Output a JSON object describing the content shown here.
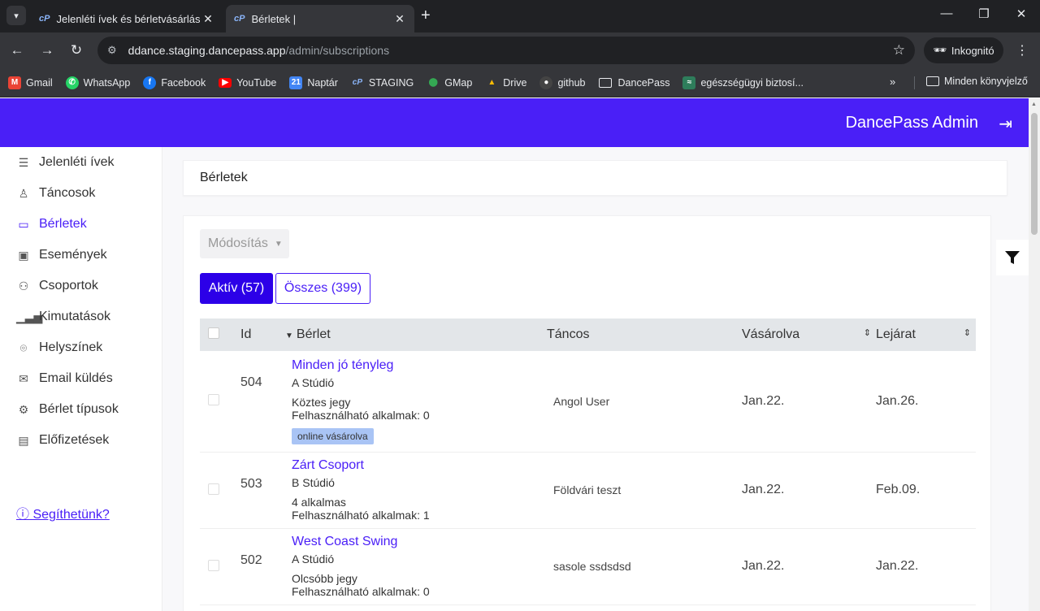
{
  "browser": {
    "tabs": [
      {
        "favicon": "cP",
        "title": "Jelenléti ívek és bérletvásárlás |",
        "active": false
      },
      {
        "favicon": "cP",
        "title": "Bérletek |",
        "active": true
      }
    ],
    "url_host": "ddance.staging.dancepass.app",
    "url_path": "/admin/subscriptions",
    "incognito_label": "Inkognitó",
    "bookmarks": [
      {
        "label": "Gmail",
        "icon": "gmail-icon",
        "color": "#ea4335"
      },
      {
        "label": "WhatsApp",
        "icon": "whatsapp-icon",
        "color": "#25d366"
      },
      {
        "label": "Facebook",
        "icon": "facebook-icon",
        "color": "#1877f2"
      },
      {
        "label": "YouTube",
        "icon": "youtube-icon",
        "color": "#ff0000"
      },
      {
        "label": "Naptár",
        "icon": "calendar-icon",
        "color": "#4285f4"
      },
      {
        "label": "STAGING",
        "icon": "dancepass-icon",
        "color": "#35363a"
      },
      {
        "label": "GMap",
        "icon": "maps-icon",
        "color": "#34a853"
      },
      {
        "label": "Drive",
        "icon": "drive-icon",
        "color": "#fbbc04"
      },
      {
        "label": "github",
        "icon": "github-icon",
        "color": "#24292e"
      },
      {
        "label": "DancePass",
        "icon": "folder-icon",
        "color": "#35363a"
      },
      {
        "label": "egészségügyi biztosí...",
        "icon": "insurance-icon",
        "color": "#2e7d5b"
      }
    ],
    "bookmarks_all": "Minden könyvjelző"
  },
  "app": {
    "title": "DancePass Admin",
    "accent": "#4a1ff7"
  },
  "sidebar": {
    "items": [
      {
        "label": "Jelenléti ívek",
        "icon": "list-icon",
        "active": false
      },
      {
        "label": "Táncosok",
        "icon": "user-icon",
        "active": false
      },
      {
        "label": "Bérletek",
        "icon": "card-icon",
        "active": true
      },
      {
        "label": "Események",
        "icon": "calendar-icon",
        "active": false
      },
      {
        "label": "Csoportok",
        "icon": "group-icon",
        "active": false
      },
      {
        "label": "Kimutatások",
        "icon": "bar-chart-icon",
        "active": false
      },
      {
        "label": "Helyszínek",
        "icon": "location-icon",
        "active": false
      },
      {
        "label": "Email küldés",
        "icon": "email-icon",
        "active": false
      },
      {
        "label": "Bérlet típusok",
        "icon": "gear-icon",
        "active": false
      },
      {
        "label": "Előfizetések",
        "icon": "credit-card-icon",
        "active": false
      }
    ],
    "help": "Segíthetünk?"
  },
  "page": {
    "breadcrumb": "Bérletek",
    "modify_label": "Módosítás",
    "filter_active": "Aktív (57)",
    "filter_all": "Összes (399)"
  },
  "table": {
    "headers": {
      "id": "Id",
      "subscription": "Bérlet",
      "dancer": "Táncos",
      "purchased": "Vásárolva",
      "expiry": "Lejárat"
    },
    "rows": [
      {
        "id": "504",
        "title": "Minden jó tényleg",
        "studio": "A Stúdió",
        "type": "Köztes jegy",
        "usable": "Felhasználható alkalmak: 0",
        "badge": "online vásárolva",
        "dancer": "Angol User",
        "purchased": "Jan.22.",
        "expiry": "Jan.26."
      },
      {
        "id": "503",
        "title": "Zárt Csoport",
        "studio": "B Stúdió",
        "type": "4 alkalmas",
        "usable": "Felhasználható alkalmak: 1",
        "badge": "",
        "dancer": "Földvári teszt",
        "purchased": "Jan.22.",
        "expiry": "Feb.09."
      },
      {
        "id": "502",
        "title": "West Coast Swing",
        "studio": "A Stúdió",
        "type": "Olcsóbb jegy",
        "usable": "Felhasználható alkalmak: 0",
        "badge": "",
        "dancer": "sasole ssdsdsd",
        "purchased": "Jan.22.",
        "expiry": "Jan.22."
      }
    ]
  }
}
